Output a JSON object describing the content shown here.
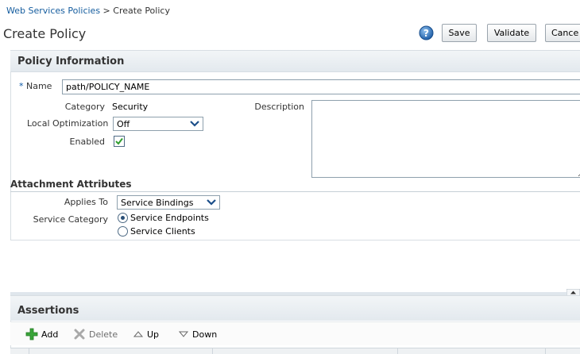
{
  "breadcrumb": {
    "parent": "Web Services Policies",
    "separator": ">",
    "current": "Create Policy"
  },
  "page": {
    "title": "Create Policy"
  },
  "toolbar": {
    "help_icon": "help-icon",
    "save_label": "Save",
    "validate_label": "Validate",
    "cancel_label": "Cance"
  },
  "policy_info": {
    "header": "Policy Information",
    "name_required_marker": "*",
    "name_label": "Name",
    "name_value": "path/POLICY_NAME",
    "category_label": "Category",
    "category_value": "Security",
    "description_label": "Description",
    "description_value": "",
    "local_opt_label": "Local Optimization",
    "local_opt_value": "Off",
    "enabled_label": "Enabled",
    "enabled_checked": true
  },
  "attachment": {
    "header": "Attachment Attributes",
    "applies_to_label": "Applies To",
    "applies_to_value": "Service Bindings",
    "service_category_label": "Service Category",
    "options": [
      {
        "label": "Service Endpoints",
        "selected": true
      },
      {
        "label": "Service Clients",
        "selected": false
      }
    ]
  },
  "assertions": {
    "header": "Assertions",
    "actions": {
      "add": "Add",
      "delete": "Delete",
      "up": "Up",
      "down": "Down"
    }
  },
  "colors": {
    "link": "#145c9e",
    "header_bg": "#e3e9ee",
    "add_icon_green": "#3aa53a"
  }
}
